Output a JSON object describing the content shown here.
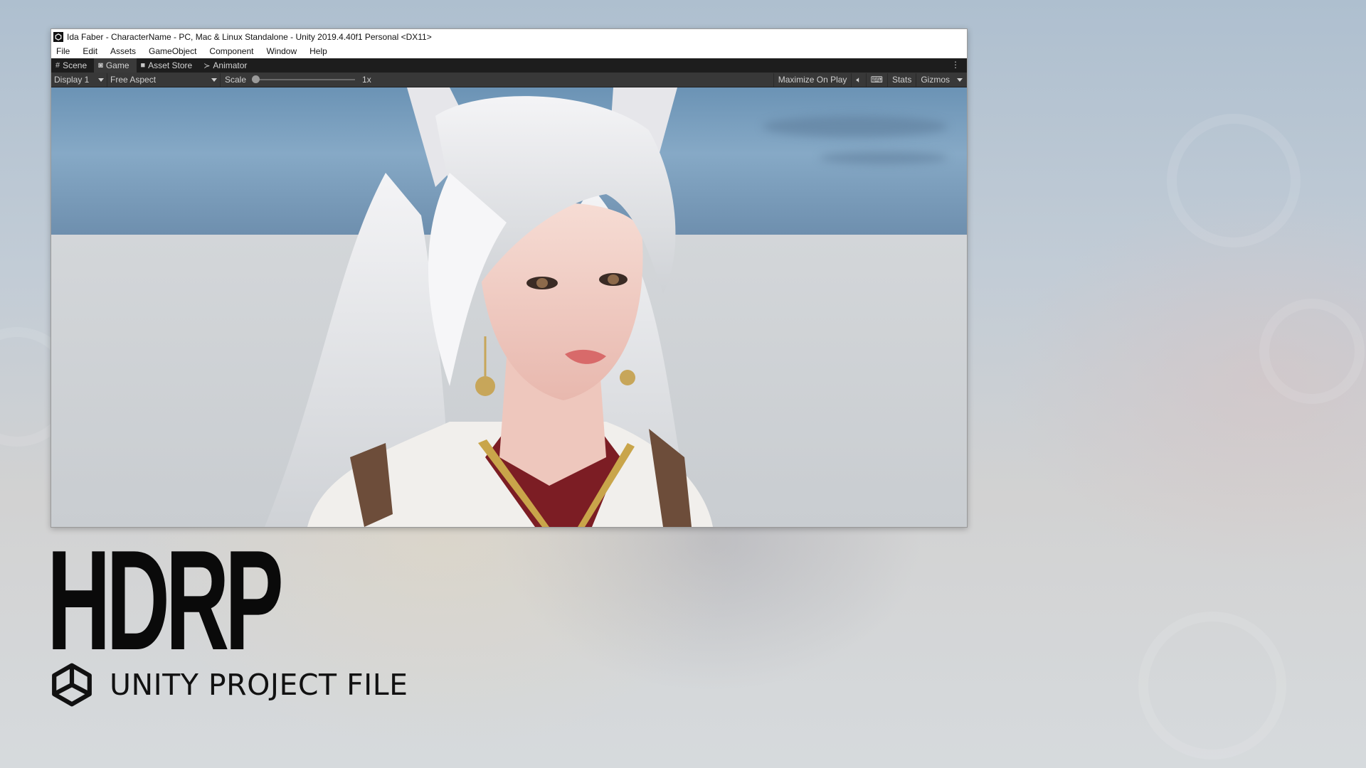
{
  "window": {
    "title": "Ida Faber - CharacterName - PC, Mac & Linux Standalone - Unity 2019.4.40f1 Personal <DX11>",
    "menu": [
      "File",
      "Edit",
      "Assets",
      "GameObject",
      "Component",
      "Window",
      "Help"
    ],
    "tabs": [
      {
        "label": "Scene",
        "icon": "grid-icon"
      },
      {
        "label": "Game",
        "icon": "gamepad-icon"
      },
      {
        "label": "Asset Store",
        "icon": "shopping-bag-icon"
      },
      {
        "label": "Animator",
        "icon": "animator-icon"
      }
    ],
    "active_tab": "Game",
    "toolbar": {
      "display": "Display 1",
      "aspect": "Free Aspect",
      "scale_label": "Scale",
      "scale_value": "1x",
      "maximize": "Maximize On Play",
      "stats": "Stats",
      "gizmos": "Gizmos"
    }
  },
  "headline": "HDRP",
  "subheadline": "UNITY PROJECT FILE",
  "colors": {
    "sky": "#7aa0c2",
    "floor": "#cfd3d7",
    "toolbar": "#383838",
    "tabbar": "#1d1d1d"
  }
}
